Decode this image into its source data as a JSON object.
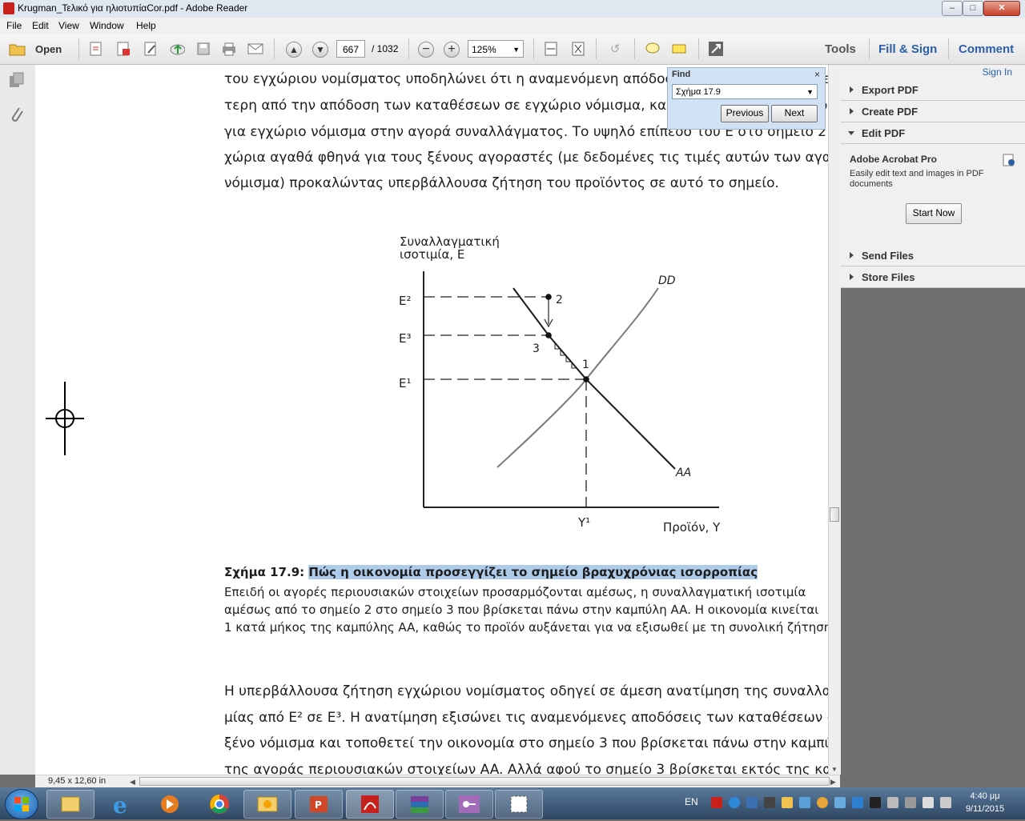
{
  "window": {
    "title": "Krugman_Τελικό για ηλιοτυπίαCor.pdf - Adobe Reader",
    "controls": [
      "–",
      "□",
      "✕"
    ]
  },
  "menu": [
    "File",
    "Edit",
    "View",
    "Window",
    "Help"
  ],
  "toolbar": {
    "open_label": "Open",
    "page_current": "667",
    "page_total": "/ 1032",
    "zoom": "125%",
    "tools_label": "Tools",
    "fill_sign_label": "Fill & Sign",
    "comment_label": "Comment"
  },
  "find": {
    "title": "Find",
    "query": "Σχήμα 17.9",
    "previous_label": "Previous",
    "next_label": "Next"
  },
  "right_panel": {
    "sign_in": "Sign In",
    "sections": {
      "export": "Export PDF",
      "create": "Create PDF",
      "edit": "Edit PDF",
      "send": "Send Files",
      "store": "Store Files"
    },
    "promo_title": "Adobe Acrobat Pro",
    "promo_text_1": "Easily edit text and images in PDF",
    "promo_text_2": "documents",
    "start_now": "Start Now"
  },
  "document": {
    "para1": [
      "του εγχώριου νομίσματος υποδηλώνει ότι η αναμενόμενη απόδοση των ξένων καταθέσεων",
      "τερη από την απόδοση των καταθέσεων σε εγχώριο νόμισμα, και έτσι εμφανίζεται υπερβάλλουσα",
      "για εγχώριο νόμισμα στην αγορά συναλλάγματος. Το υψηλό επίπεδο του E στο σημείο 2",
      "χώρια αγαθά φθηνά για τους ξένους αγοραστές (με δεδομένες τις τιμές αυτών των αγαθών",
      "νόμισμα) προκαλώντας υπερβάλλουσα ζήτηση του προϊόντος σε αυτό το σημείο."
    ],
    "figure": {
      "y_title_1": "Συναλλαγματική",
      "y_title_2": "ισοτιμία, E",
      "e2": "E²",
      "e3": "E³",
      "e1": "E¹",
      "y1": "Y¹",
      "x_title": "Προϊόν, Y",
      "dd": "DD",
      "aa": "AA",
      "p1": "1",
      "p2": "2",
      "p3": "3"
    },
    "caption_bold": "Σχήμα 17.9:",
    "caption_title": "Πώς η οικονομία προσεγγίζει το σημείο βραχυχρόνιας ισορροπίας",
    "caption_lines": [
      "Επειδή οι αγορές περιουσιακών στοιχείων προσαρμόζονται αμέσως, η συναλλαγματική ισοτιμία",
      "αμέσως από το σημείο 2 στο σημείο 3 που βρίσκεται πάνω στην καμπύλη AA. Η οικονομία κινείται",
      "1 κατά μήκος της καμπύλης AA, καθώς το προϊόν αυξάνεται για να εξισωθεί με τη συνολική ζήτηση"
    ],
    "para2": [
      "Η υπερβάλλουσα ζήτηση εγχώριου νομίσματος οδηγεί σε άμεση ανατίμηση της συναλλαγματικής",
      "μίας από E² σε E³. Η ανατίμηση εξισώνει τις αναμενόμενες αποδόσεις των καταθέσεων σε",
      "ξένο νόμισμα και τοποθετεί την οικονομία στο σημείο 3 που βρίσκεται πάνω στην καμπύλη",
      "της αγοράς περιουσιακών στοιχείων AA. Αλλά αφού το σημείο 3 βρίσκεται εκτός της καμπύλης"
    ]
  },
  "status": {
    "page_size": "9,45 x 12,60 in"
  },
  "taskbar": {
    "lang": "EN",
    "time": "4:40 μμ",
    "date": "9/11/2015"
  },
  "colors": {
    "find_highlight": "#aecbe9",
    "curve_dd": "#7a7a7a",
    "curve_aa": "#1a1a1a",
    "accent_blue": "#2c5fa8"
  }
}
